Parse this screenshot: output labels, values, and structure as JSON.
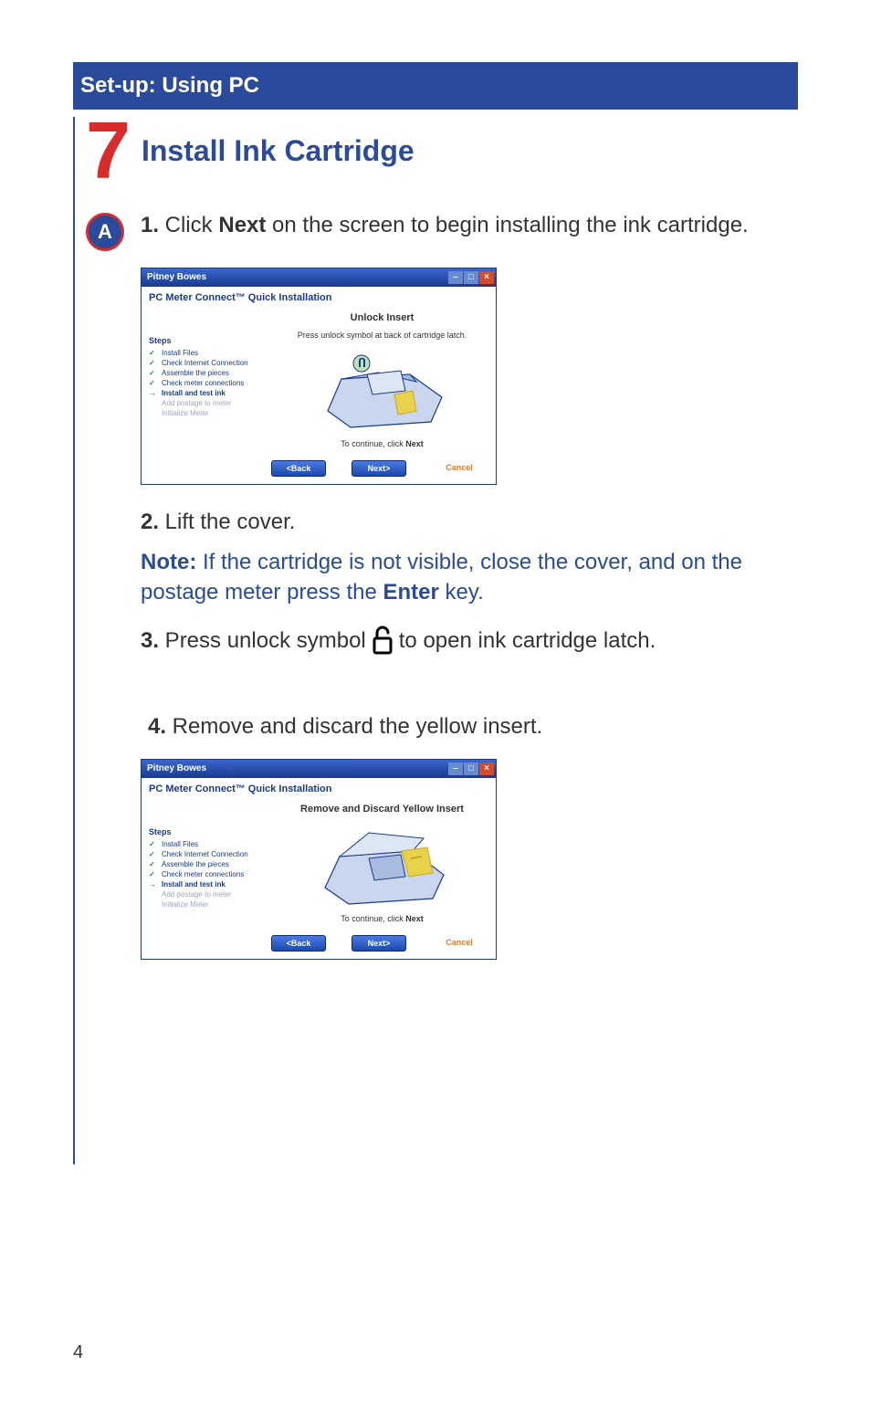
{
  "header": {
    "title": "Set-up: Using PC"
  },
  "step": {
    "number": "7",
    "title": "Install Ink Cartridge"
  },
  "badge": "A",
  "lines": {
    "l1_num": "1.",
    "l1_a": " Click ",
    "l1_bold": "Next",
    "l1_b": " on the screen to begin installing the ink cartridge.",
    "l2_num": "2.",
    "l2": " Lift the cover.",
    "note_label": "Note:",
    "note_a": " If the cartridge is not visible, close the cover, and on the postage meter press the ",
    "note_bold": "Enter",
    "note_b": " key.",
    "l3_num": "3.",
    "l3_a": " Press unlock symbol ",
    "l3_b": " to open ink cartridge latch.",
    "l4_num": "4.",
    "l4": " Remove and discard the yellow insert."
  },
  "window": {
    "titlebar": "Pitney Bowes",
    "subtitle": "PC Meter Connect™ Quick Installation",
    "steps_heading": "Steps",
    "steps": [
      {
        "icon": "check",
        "label": "Install Files"
      },
      {
        "icon": "check",
        "label": "Check Internet Connection"
      },
      {
        "icon": "check",
        "label": "Assemble the pieces"
      },
      {
        "icon": "check",
        "label": "Check meter connections"
      },
      {
        "icon": "arrow",
        "label": "Install and test ink"
      },
      {
        "icon": "none",
        "label": "Add postage to meter"
      },
      {
        "icon": "none",
        "label": "Initialize Meter"
      }
    ],
    "screen1": {
      "title": "Unlock Insert",
      "subtitle": "Press unlock symbol at back of cartridge latch."
    },
    "screen2": {
      "title": "Remove and Discard Yellow Insert",
      "subtitle": ""
    },
    "continue_a": "To continue, click  ",
    "continue_bold": "Next",
    "buttons": {
      "back": "<Back",
      "next": "Next>",
      "cancel": "Cancel"
    }
  },
  "page_number": "4"
}
